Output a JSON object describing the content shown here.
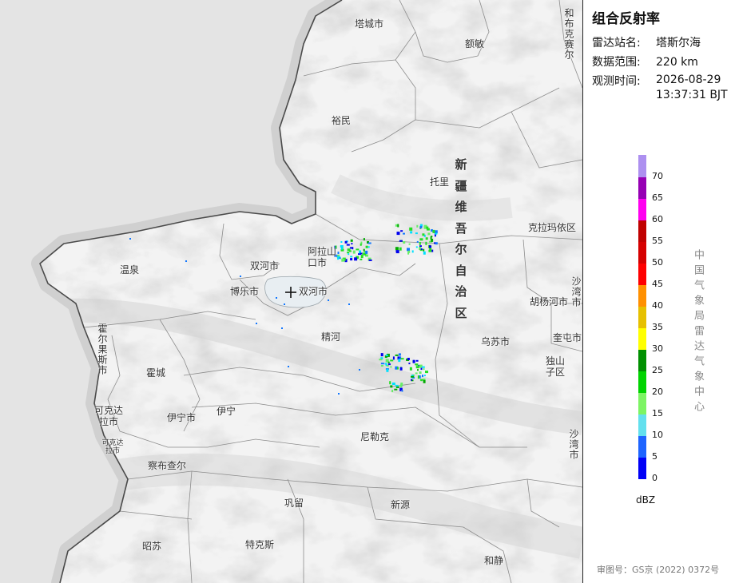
{
  "map": {
    "places": [
      {
        "name": "塔城市"
      },
      {
        "name": "额敏"
      },
      {
        "name": "和布克赛尔"
      },
      {
        "name": "裕民"
      },
      {
        "name": "托里"
      },
      {
        "name": "克拉玛依区"
      },
      {
        "name": "温泉"
      },
      {
        "name": "双河市"
      },
      {
        "name": "阿拉山口市"
      },
      {
        "name": "博乐市"
      },
      {
        "name": "双河市"
      },
      {
        "name": "沙湾市"
      },
      {
        "name": "胡杨河市"
      },
      {
        "name": "精河"
      },
      {
        "name": "乌苏市"
      },
      {
        "name": "奎屯市"
      },
      {
        "name": "独山子区"
      },
      {
        "name": "霍尔果斯市"
      },
      {
        "name": "霍城"
      },
      {
        "name": "可克达拉市"
      },
      {
        "name": "伊宁市"
      },
      {
        "name": "伊宁"
      },
      {
        "name": "可克达拉市"
      },
      {
        "name": "察布查尔"
      },
      {
        "name": "尼勒克"
      },
      {
        "name": "沙湾市"
      },
      {
        "name": "巩留"
      },
      {
        "name": "新源"
      },
      {
        "name": "昭苏"
      },
      {
        "name": "特克斯"
      },
      {
        "name": "和静"
      }
    ],
    "region_label": "新疆维吾尔自治区",
    "colors": {
      "land": "#f2f2f2",
      "neighbor": "#e2e2e2",
      "boundary": "#777777",
      "border": "#4a4a4a",
      "station_marker": "#111111"
    },
    "echo_colors": [
      "#00e0ff",
      "#22dd22",
      "#66ee66",
      "#1177ff",
      "#0000ee",
      "#00aa00"
    ]
  },
  "info": {
    "title": "组合反射率",
    "station_label": "雷达站名:",
    "station_value": "塔斯尔海",
    "range_label": "数据范围:",
    "range_value": "220 km",
    "time_label": "观测时间:",
    "time_date": "2026-08-29",
    "time_clock": "13:37:31 BJT"
  },
  "legend": {
    "unit": "dBZ",
    "ticks": [
      "70",
      "65",
      "60",
      "55",
      "50",
      "45",
      "40",
      "35",
      "30",
      "25",
      "20",
      "15",
      "10",
      "5",
      "0"
    ],
    "colors": [
      "#0000f6",
      "#1e64ff",
      "#63e0ee",
      "#7df464",
      "#00d400",
      "#009000",
      "#ffff00",
      "#e6c000",
      "#ff9000",
      "#ff0000",
      "#d60000",
      "#c00000",
      "#ff00f0",
      "#9600b4",
      "#ad90f0"
    ]
  },
  "issuer": "中国气象局雷达气象中心",
  "approval": "审图号：GS京 (2022) 0372号"
}
